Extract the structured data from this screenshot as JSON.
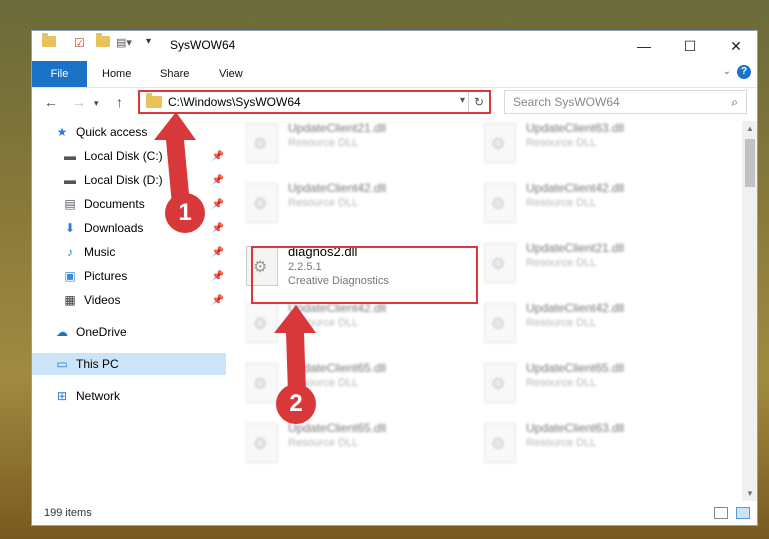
{
  "window": {
    "title": "SysWOW64"
  },
  "ribbon": {
    "file": "File",
    "home": "Home",
    "share": "Share",
    "view": "View"
  },
  "address": {
    "path": "C:\\Windows\\SysWOW64",
    "search_placeholder": "Search SysWOW64"
  },
  "nav": {
    "items": [
      {
        "label": "Quick access",
        "icon": "star-icon",
        "pinned": false
      },
      {
        "label": "Local Disk (C:)",
        "icon": "drive-icon",
        "pinned": true
      },
      {
        "label": "Local Disk (D:)",
        "icon": "drive-icon",
        "pinned": true
      },
      {
        "label": "Documents",
        "icon": "documents-icon",
        "pinned": true
      },
      {
        "label": "Downloads",
        "icon": "download-icon",
        "pinned": true
      },
      {
        "label": "Music",
        "icon": "music-icon",
        "pinned": true
      },
      {
        "label": "Pictures",
        "icon": "pictures-icon",
        "pinned": true
      },
      {
        "label": "Videos",
        "icon": "videos-icon",
        "pinned": true
      },
      {
        "label": "OneDrive",
        "icon": "cloud-icon",
        "pinned": false
      },
      {
        "label": "This PC",
        "icon": "computer-icon",
        "pinned": false
      },
      {
        "label": "Network",
        "icon": "network-icon",
        "pinned": false
      }
    ]
  },
  "files": {
    "left": [
      {
        "name": "UpdateClient21.dll",
        "sub": "Resource DLL"
      },
      {
        "name": "UpdateClient42.dll",
        "sub": "Resource DLL"
      },
      {
        "name": "diagnos2.dll",
        "version": "2.2.5.1",
        "company": "Creative Diagnostics"
      },
      {
        "name": "UpdateClient42.dll",
        "sub": "Resource DLL"
      },
      {
        "name": "UpdateClient65.dll",
        "sub": "Resource DLL"
      },
      {
        "name": "UpdateClient65.dll",
        "sub": "Resource DLL"
      }
    ],
    "right": [
      {
        "name": "UpdateClient63.dll",
        "sub": "Resource DLL"
      },
      {
        "name": "UpdateClient42.dll",
        "sub": "Resource DLL"
      },
      {
        "name": "UpdateClient21.dll",
        "sub": "Resource DLL"
      },
      {
        "name": "UpdateClient42.dll",
        "sub": "Resource DLL"
      },
      {
        "name": "UpdateClient65.dll",
        "sub": "Resource DLL"
      },
      {
        "name": "UpdateClient63.dll",
        "sub": "Resource DLL"
      }
    ]
  },
  "status": {
    "count": "199 items"
  },
  "callouts": {
    "one": "1",
    "two": "2"
  },
  "colors": {
    "accent": "#1a73c7",
    "highlight": "#d9383a"
  }
}
